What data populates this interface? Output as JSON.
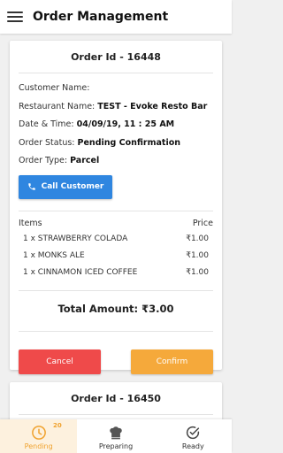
{
  "header": {
    "title": "Order Management",
    "menu_icon": "hamburger-icon"
  },
  "orders": [
    {
      "order_id_label": "Order Id - 16448",
      "customer_name": "Customer Name:",
      "restaurant_label": "Restaurant Name:",
      "restaurant_value": "TEST - Evoke Resto Bar",
      "datetime_label": "Date & Time:",
      "datetime_value": "04/09/19, 11 : 25 AM",
      "status_label": "Order Status:",
      "status_value": "Pending Confirmation",
      "type_label": "Order Type:",
      "type_value": "Parcel",
      "call_button": "Call Customer",
      "items_header": "Items",
      "price_header": "Price",
      "items": [
        {
          "name": "1 x STRAWBERRY COLADA",
          "price": "₹1.00"
        },
        {
          "name": "1 x MONKS ALE",
          "price": "₹1.00"
        },
        {
          "name": "1 x CINNAMON ICED COFFEE",
          "price": "₹1.00"
        }
      ],
      "total": "Total Amount: ₹3.00",
      "cancel_button": "Cancel",
      "confirm_button": "Confirm"
    },
    {
      "order_id_label": "Order Id - 16450"
    }
  ],
  "bottom_nav": [
    {
      "label": "Pending",
      "badge": "20",
      "icon": "clock-icon",
      "active": true
    },
    {
      "label": "Preparing",
      "icon": "chef-hat-icon",
      "active": false
    },
    {
      "label": "Ready",
      "icon": "check-circle-icon",
      "active": false
    }
  ],
  "colors": {
    "call": "#2f86e0",
    "cancel": "#ef4a4a",
    "confirm": "#f5a93b",
    "accent": "#f0a22e"
  }
}
